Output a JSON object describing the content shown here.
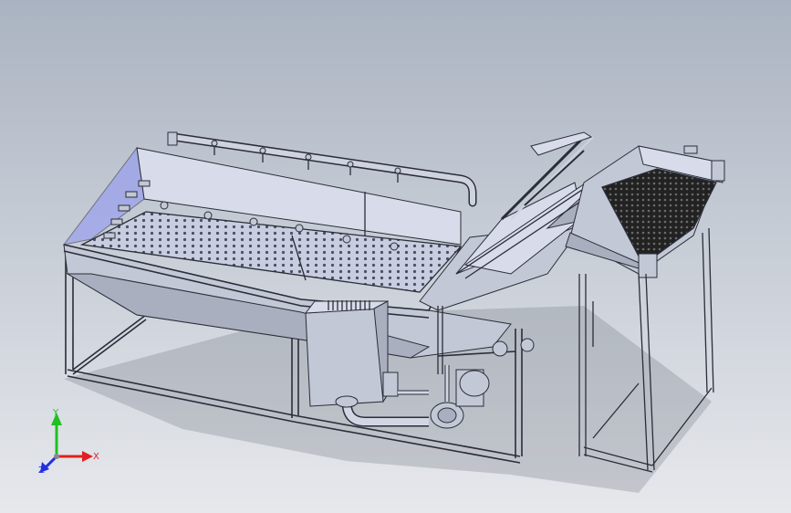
{
  "viewport": {
    "name": "3d-cad-viewport",
    "background_top": "#aab3c1",
    "background_bottom": "#e6e8ec"
  },
  "model": {
    "body_color": "#c3c8d6",
    "body_shade": "#a9afbf",
    "body_light": "#d8dcea",
    "edge_color": "#2b2d38",
    "highlight_color": "#8d93f5",
    "conveyor_belt_color": "#2a2a2a"
  },
  "triad": {
    "x_label": "X",
    "y_label": "Y",
    "z_label": "Z",
    "x_color": "#e02020",
    "y_color": "#20c020",
    "z_color": "#2030e0"
  }
}
